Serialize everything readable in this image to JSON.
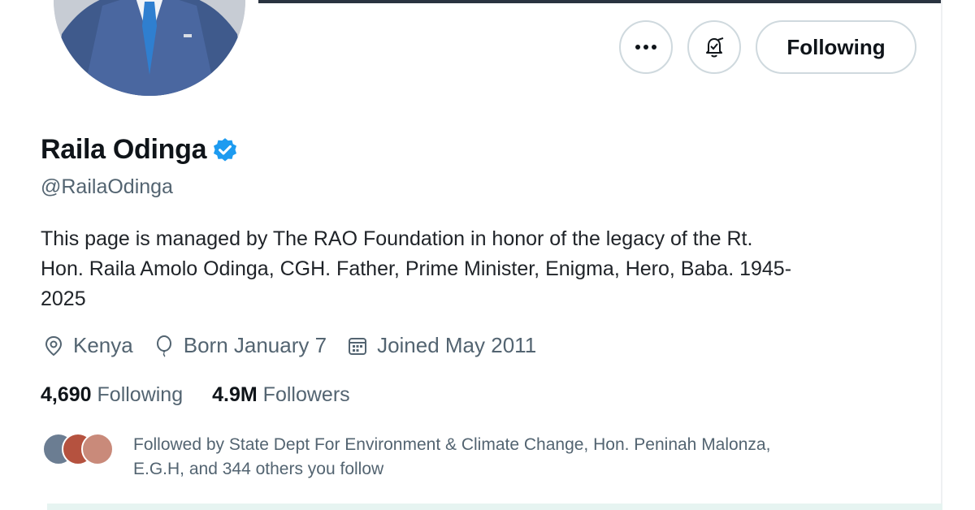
{
  "profile": {
    "name": "Raila Odinga",
    "handle": "@RailaOdinga",
    "bio_lines": [
      "This page is managed by The RAO Foundation in honor of the legacy of the Rt.",
      "Hon. Raila Amolo Odinga, CGH. Father, Prime Minister, Enigma, Hero, Baba. 1945-",
      "2025"
    ],
    "location": "Kenya",
    "birthday": "Born January 7",
    "joined": "Joined May 2011"
  },
  "actions": {
    "more_icon": "more-dots-icon",
    "notify_icon": "bell-notification-icon",
    "following_label": "Following"
  },
  "stats": {
    "following_count": "4,690",
    "following_label": "Following",
    "followers_count": "4.9M",
    "followers_label": "Followers"
  },
  "followed_by": {
    "line1": "Followed by State Dept For Environment & Climate Change, Hon. Peninah Malonza,",
    "line2": "E.G.H, and 344 others you follow"
  },
  "colors": {
    "verified_blue": "#1d9bf0",
    "muted_text": "#536471",
    "border": "#cfd9de"
  }
}
